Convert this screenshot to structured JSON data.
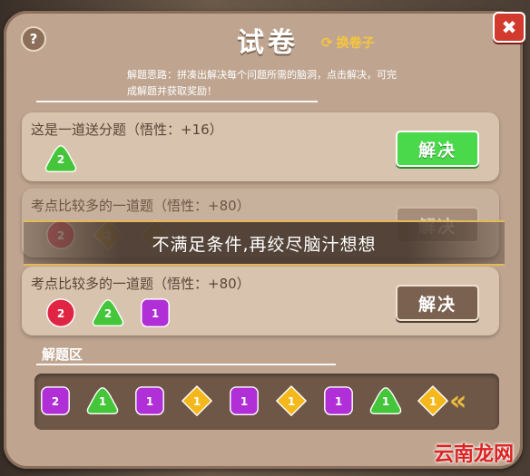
{
  "window": {
    "title": "试卷",
    "swap_label": "换卷子",
    "help_label": "?",
    "close_label": "✖"
  },
  "tip": "解题思路：拼凑出解决每个问题所需的脑洞，点击解决，可完成解题并获取奖励！",
  "questions": [
    {
      "title": "这是一道送分题（悟性：+16）",
      "button": "解决",
      "pieces": [
        {
          "shape": "triangle",
          "color": "green",
          "n": "2"
        }
      ]
    },
    {
      "title": "考点比较多的一道题（悟性：+80）",
      "button": "解决",
      "pieces": [
        {
          "shape": "circle",
          "color": "red",
          "n": "2"
        },
        {
          "shape": "diamond",
          "color": "yellow",
          "n": "2"
        },
        {
          "shape": "diamond",
          "color": "yellow",
          "n": ""
        }
      ]
    },
    {
      "title": "考点比较多的一道题（悟性：+80）",
      "button": "解决",
      "pieces": [
        {
          "shape": "circle",
          "color": "red",
          "n": "2"
        },
        {
          "shape": "triangle",
          "color": "green",
          "n": "2"
        },
        {
          "shape": "square",
          "color": "purple",
          "n": "1"
        }
      ]
    }
  ],
  "toast": "不满足条件,再绞尽脑汁想想",
  "zone_label": "解题区",
  "tray": [
    {
      "shape": "square",
      "color": "purple",
      "n": "2"
    },
    {
      "shape": "triangle",
      "color": "green",
      "n": "1"
    },
    {
      "shape": "square",
      "color": "purple",
      "n": "1"
    },
    {
      "shape": "diamond",
      "color": "yellow",
      "n": "1"
    },
    {
      "shape": "square",
      "color": "purple",
      "n": "1"
    },
    {
      "shape": "diamond",
      "color": "yellow",
      "n": "1"
    },
    {
      "shape": "square",
      "color": "purple",
      "n": "1"
    },
    {
      "shape": "triangle",
      "color": "green",
      "n": "1"
    },
    {
      "shape": "diamond",
      "color": "yellow",
      "n": "1"
    }
  ],
  "watermark": "云南龙网",
  "colors": {
    "green": "#45c63a",
    "red": "#e02443",
    "yellow": "#f4b81c",
    "purple": "#b02fd6"
  }
}
